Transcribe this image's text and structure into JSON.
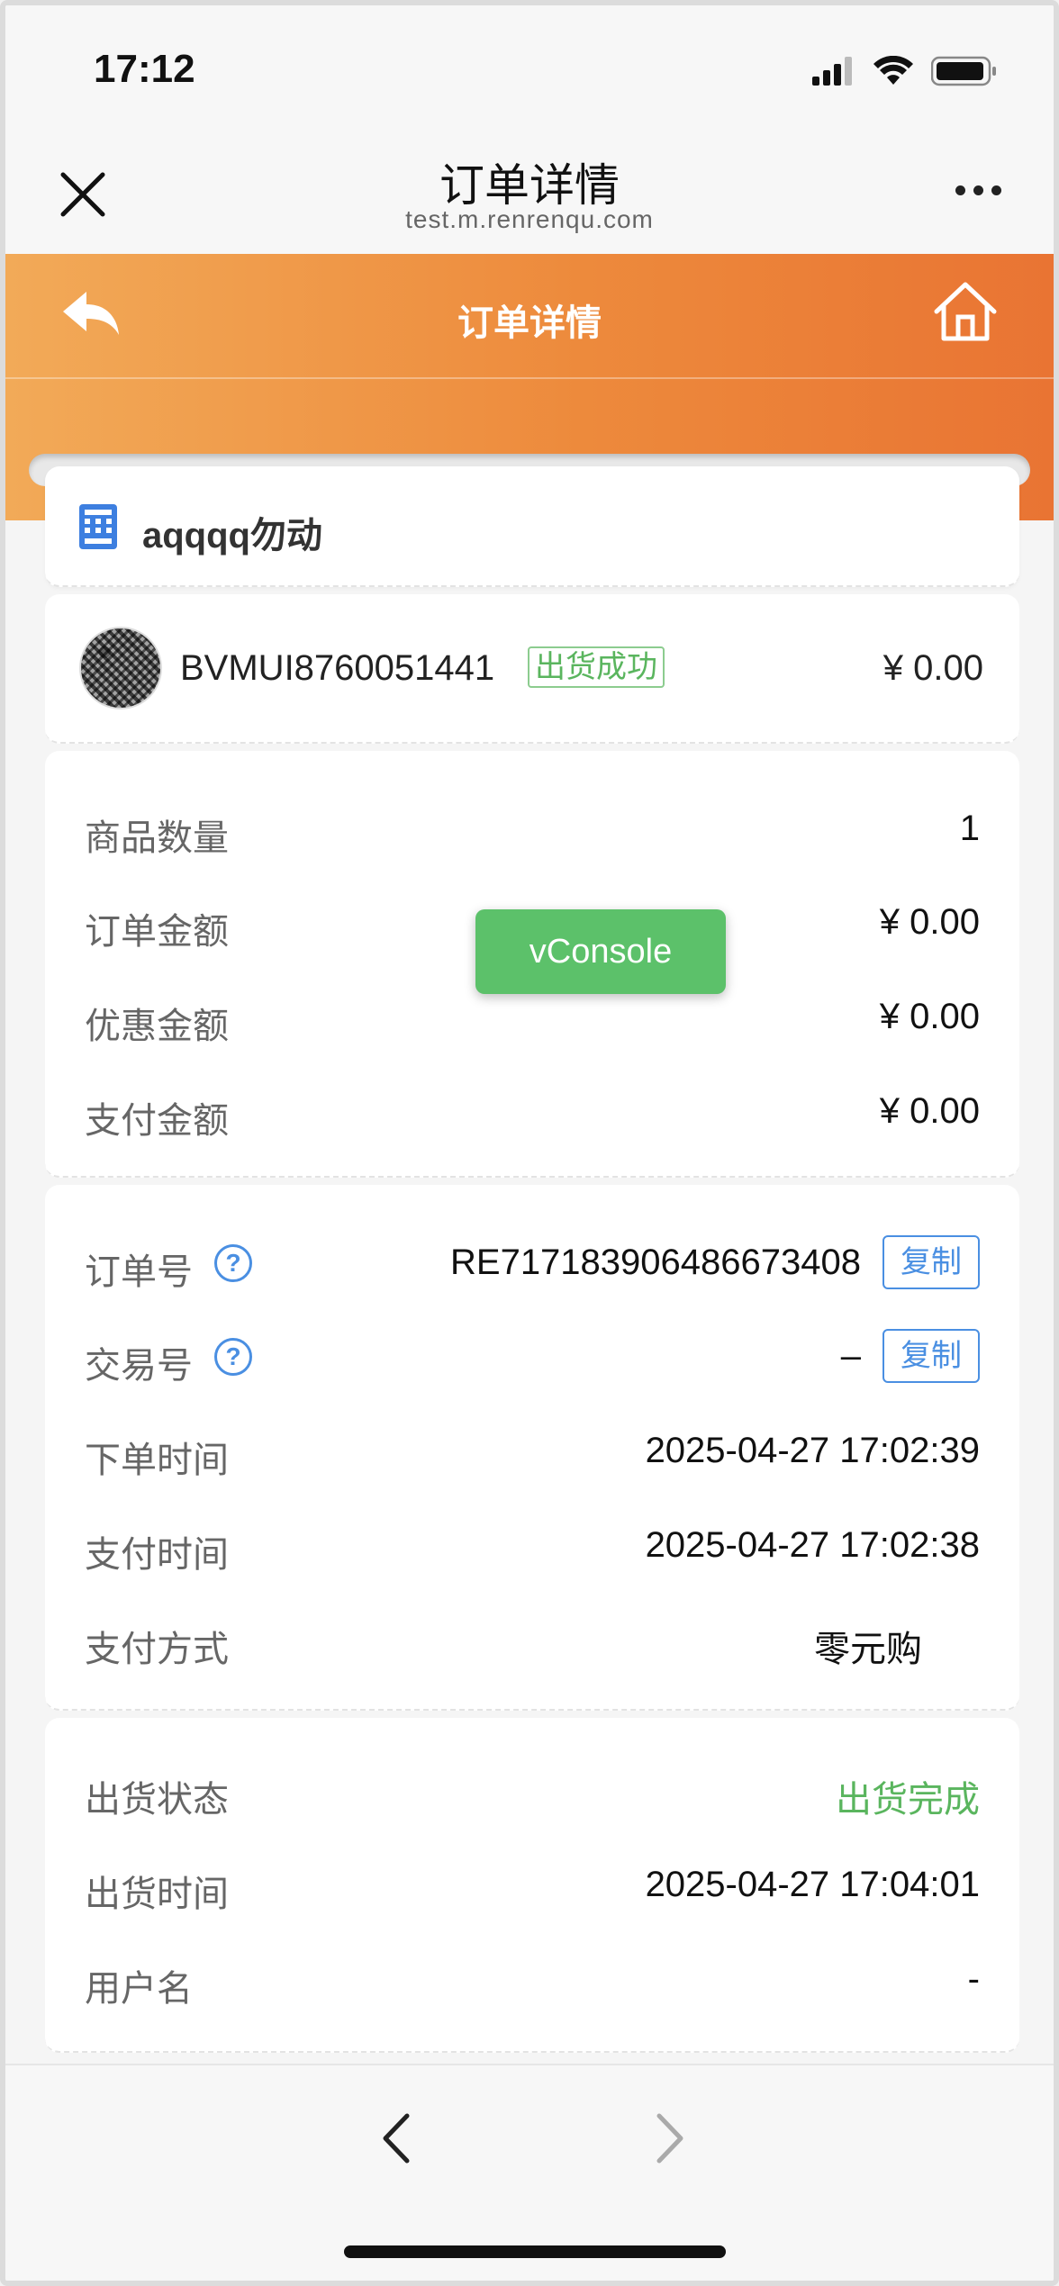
{
  "status_bar": {
    "time": "17:12"
  },
  "browser_nav": {
    "title": "订单详情",
    "url": "test.m.renrenqu.com"
  },
  "page_header": {
    "title": "订单详情"
  },
  "store": {
    "name": "aqqqq勿动"
  },
  "product": {
    "code": "BVMUI8760051441",
    "badge": "出货成功",
    "price": "¥ 0.00"
  },
  "amounts": [
    {
      "label": "商品数量",
      "value": "1"
    },
    {
      "label": "订单金额",
      "value": "¥ 0.00"
    },
    {
      "label": "优惠金额",
      "value": "¥ 0.00"
    },
    {
      "label": "支付金额",
      "value": "¥ 0.00"
    }
  ],
  "order_info": {
    "order_no_label": "订单号",
    "order_no": "RE717183906486673408",
    "trade_no_label": "交易号",
    "trade_no": "–",
    "copy_label": "复制",
    "help_glyph": "?",
    "order_time_label": "下单时间",
    "order_time": "2025-04-27 17:02:39",
    "pay_time_label": "支付时间",
    "pay_time": "2025-04-27 17:02:38",
    "pay_method_label": "支付方式",
    "pay_method": "零元购"
  },
  "shipment": {
    "status_label": "出货状态",
    "status": "出货完成",
    "time_label": "出货时间",
    "time": "2025-04-27 17:04:01",
    "username_label": "用户名",
    "username": "-"
  },
  "vconsole": {
    "label": "vConsole"
  },
  "colors": {
    "header_gradient_start": "#f2aa58",
    "header_gradient_end": "#e97433",
    "accent_blue": "#4a8fe2",
    "success_green": "#5ab55e",
    "vconsole_green": "#5cc16a"
  }
}
